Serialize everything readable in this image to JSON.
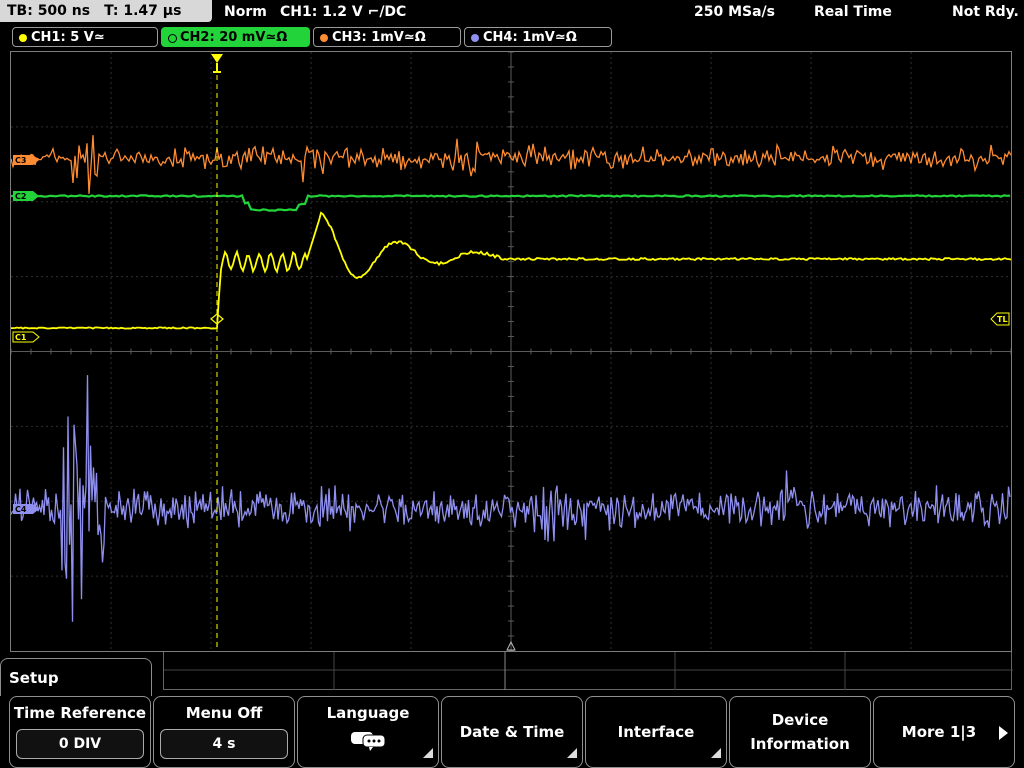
{
  "header": {
    "timebase": "TB: 500 ns",
    "trigger_time": "T: 1.47 µs",
    "mode": "Norm",
    "trigger": "CH1: 1.2 V ⌐/DC",
    "sample_rate": "250 MSa/s",
    "acq_mode": "Real Time",
    "status": "Not Rdy."
  },
  "channels": [
    {
      "id": "ch1",
      "label": "CH1: 5 V≃",
      "color": "#ffff00",
      "active": false
    },
    {
      "id": "ch2",
      "label": "CH2: 20 mV≃Ω",
      "color": "#22d33a",
      "active": true
    },
    {
      "id": "ch3",
      "label": "CH3: 1mV≃Ω",
      "color": "#ff8c32",
      "active": false
    },
    {
      "id": "ch4",
      "label": "CH4: 1mV≃Ω",
      "color": "#8f8ff0",
      "active": false
    }
  ],
  "markers": {
    "ch1": "C1",
    "ch2": "C2",
    "ch3": "C3",
    "ch4": "C4",
    "trigger_level": "TL",
    "trigger_pos": "T"
  },
  "menu": {
    "title": "Setup",
    "softkeys": [
      {
        "label": "Time Reference",
        "value": "0 DIV"
      },
      {
        "label": "Menu Off",
        "value": "4 s"
      },
      {
        "label": "Language",
        "icon": "speech-bubble-icon"
      },
      {
        "label": "Date & Time"
      },
      {
        "label": "Interface"
      },
      {
        "label": "Device",
        "label2": "Information"
      },
      {
        "label": "More 1|3"
      }
    ]
  }
}
